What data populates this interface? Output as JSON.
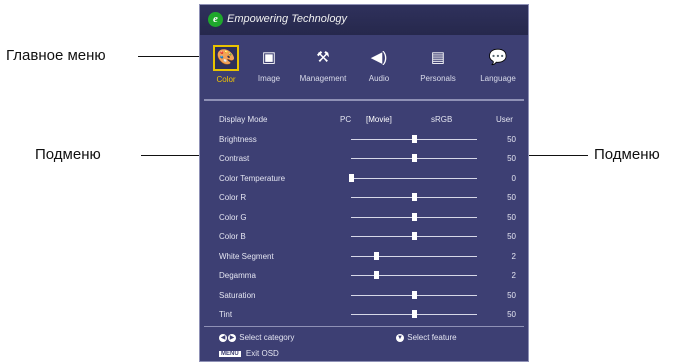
{
  "callouts": {
    "main_menu": "Главное меню",
    "submenu_left": "Подменю",
    "submenu_right": "Подменю"
  },
  "osd": {
    "brand": "Empowering Technology",
    "brand_icon": "e",
    "tabs": [
      {
        "label": "Color",
        "icon": "palette-icon",
        "glyph": "🎨",
        "active": true
      },
      {
        "label": "Image",
        "icon": "picture-icon",
        "glyph": "▣",
        "active": false
      },
      {
        "label": "Management",
        "icon": "tools-icon",
        "glyph": "⚒",
        "active": false
      },
      {
        "label": "Audio",
        "icon": "speaker-icon",
        "glyph": "◀)",
        "active": false
      },
      {
        "label": "Personals",
        "icon": "document-icon",
        "glyph": "▤",
        "active": false
      },
      {
        "label": "Language",
        "icon": "speech-bubble-icon",
        "glyph": "💬",
        "active": false
      }
    ],
    "display_mode": {
      "label": "Display Mode",
      "options": [
        "PC",
        "[Movie]",
        "sRGB",
        "User"
      ]
    },
    "items": [
      {
        "label": "Brightness",
        "value": "50",
        "level": 0.5
      },
      {
        "label": "Contrast",
        "value": "50",
        "level": 0.5
      },
      {
        "label": "Color Temperature",
        "value": "0",
        "level": 0.0
      },
      {
        "label": "Color R",
        "value": "50",
        "level": 0.5
      },
      {
        "label": "Color G",
        "value": "50",
        "level": 0.5
      },
      {
        "label": "Color B",
        "value": "50",
        "level": 0.5
      },
      {
        "label": "White Segment",
        "value": "2",
        "level": 0.2
      },
      {
        "label": "Degamma",
        "value": "2",
        "level": 0.2
      },
      {
        "label": "Saturation",
        "value": "50",
        "level": 0.5
      },
      {
        "label": "Tint",
        "value": "50",
        "level": 0.5
      }
    ],
    "footer": {
      "select_category": "Select category",
      "select_feature": "Select feature",
      "menu_key": "MENU",
      "exit": "Exit OSD"
    }
  }
}
